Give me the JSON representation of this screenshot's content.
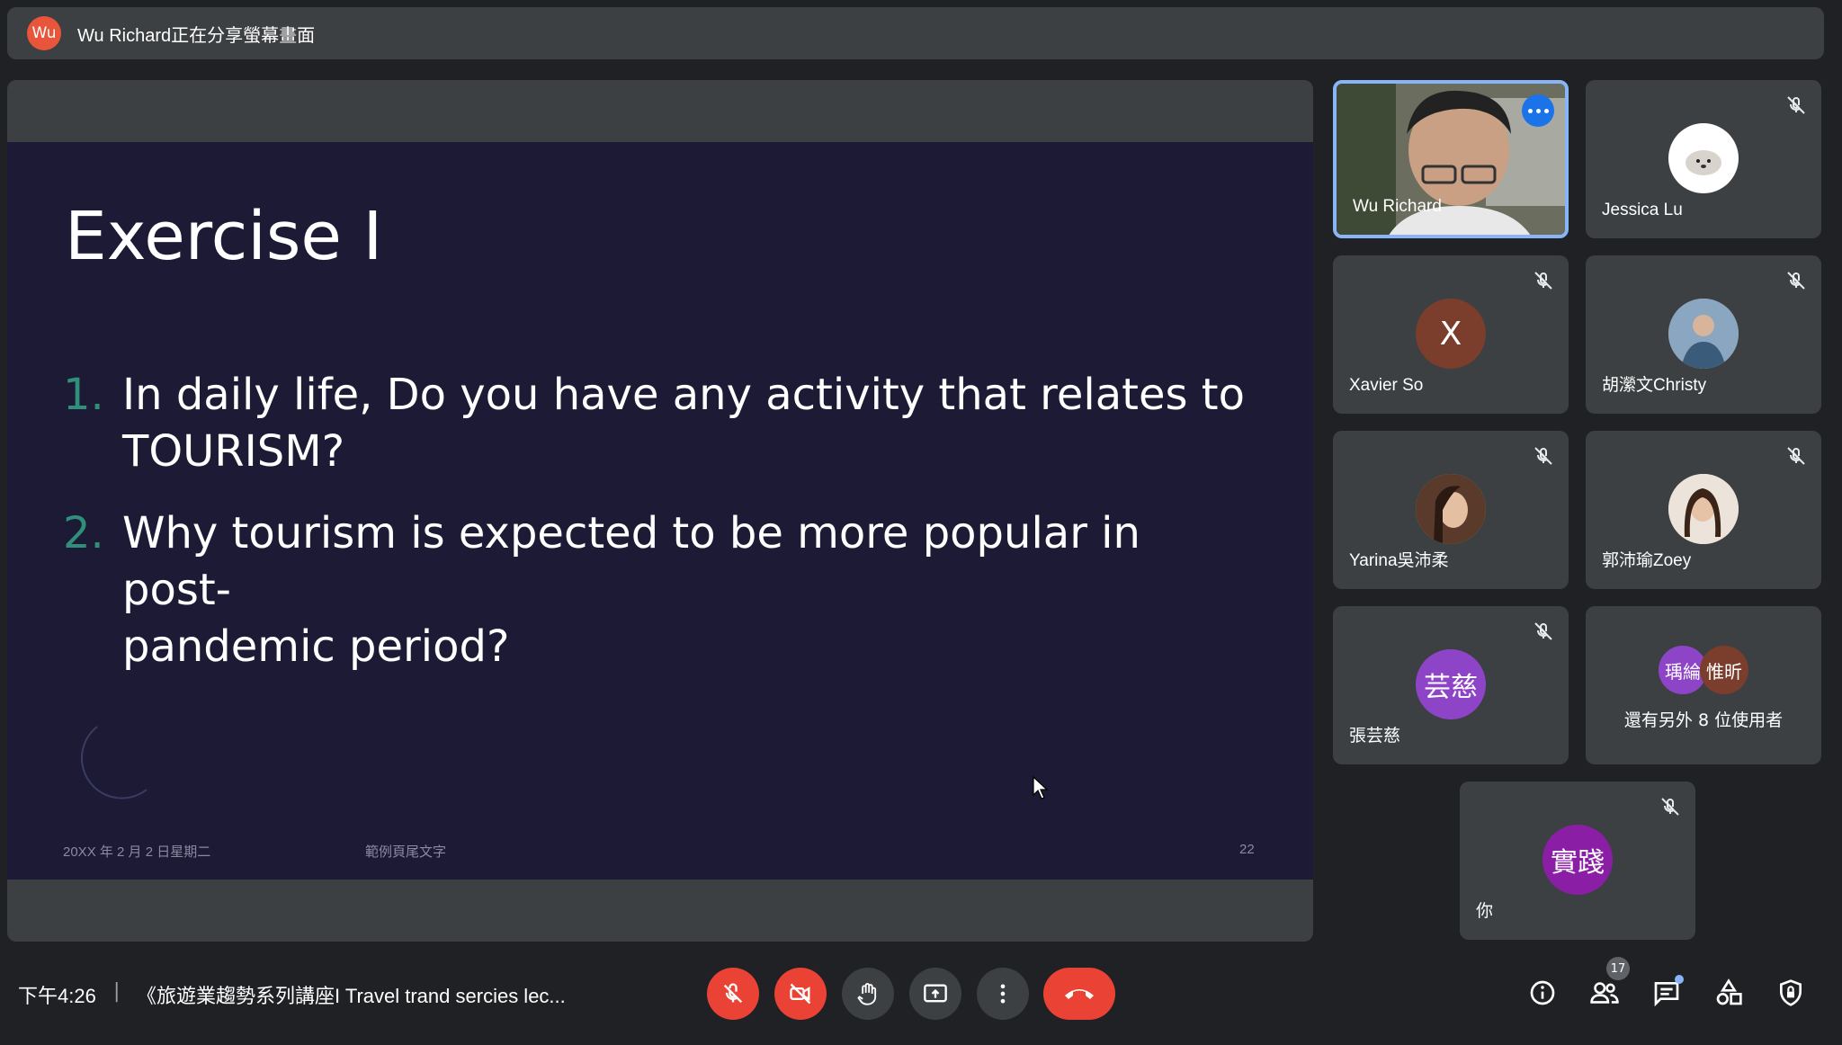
{
  "banner": {
    "presenter_initials": "Wu",
    "text": "Wu Richard正在分享螢幕畫面"
  },
  "slide": {
    "title": "Exercise I",
    "questions": [
      {
        "num": "1.",
        "line1": "In daily life, Do you have any activity that relates to",
        "line2": "TOURISM?"
      },
      {
        "num": "2.",
        "line1": "Why tourism is expected to be more popular in post-",
        "line2": "pandemic period?"
      }
    ],
    "footer_date": "20XX 年 2 月 2 日星期二",
    "footer_text": "範例頁尾文字",
    "page_number": "22"
  },
  "participants": [
    {
      "name": "Wu Richard",
      "initial": "",
      "color": "#5a5f55"
    },
    {
      "name": "Jessica Lu",
      "initial": "",
      "color": "#ffffff"
    },
    {
      "name": "Xavier So",
      "initial": "X",
      "color": "#7b3d2c"
    },
    {
      "name": "胡瀠文Christy",
      "initial": "",
      "color": "#b79a84"
    },
    {
      "name": "Yarina吳沛柔",
      "initial": "",
      "color": "#c49b7e"
    },
    {
      "name": "郭沛瑜Zoey",
      "initial": "",
      "color": "#e3c9b5"
    },
    {
      "name": "張芸慈",
      "initial": "芸慈",
      "color": "#8e44c7"
    },
    {
      "name": "你",
      "initial": "實踐",
      "color": "#8a1fa6"
    }
  ],
  "others": {
    "a": "瑀綸",
    "b": "惟昕",
    "text": "還有另外 8 位使用者",
    "color_a": "#8e44c7",
    "color_b": "#7b3d2c"
  },
  "bottom": {
    "time": "下午4:26",
    "separator": "|",
    "meeting_title": "《旅遊業趨勢系列講座I Travel trand sercies lec...",
    "people_count": "17"
  }
}
